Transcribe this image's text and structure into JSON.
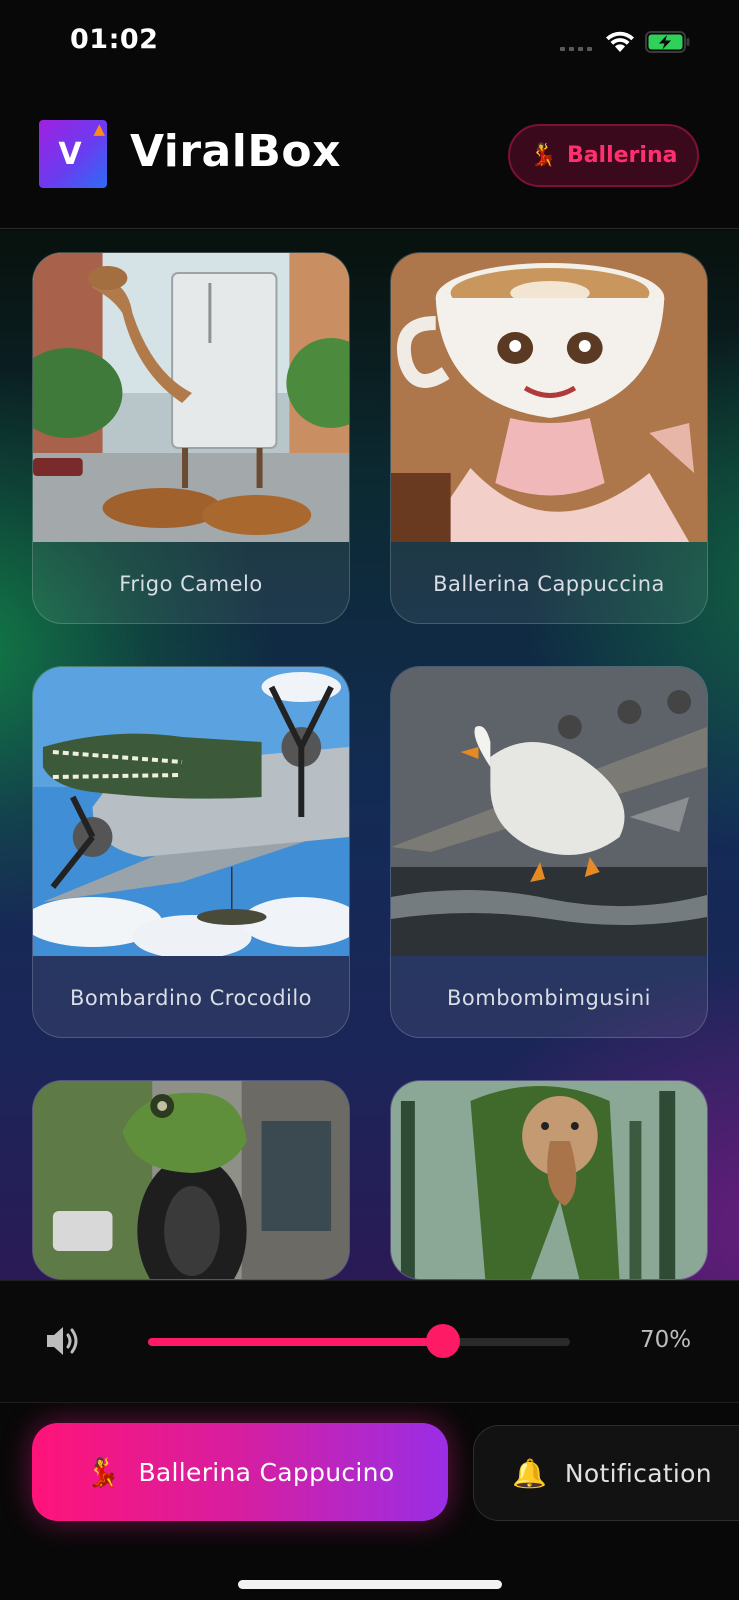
{
  "status_bar": {
    "time": "01:02"
  },
  "header": {
    "app_name": "ViralBox",
    "logo_letter": "V",
    "logo_icon": "flame-icon",
    "pill": {
      "emoji": "💃",
      "label": "Ballerina"
    }
  },
  "cards": [
    {
      "title": "Frigo Camelo",
      "image": "camel-fridge-image"
    },
    {
      "title": "Ballerina Cappuccina",
      "image": "ballerina-cappuccina-image"
    },
    {
      "title": "Bombardino Crocodilo",
      "image": "crocodile-bomber-image"
    },
    {
      "title": "Bombombimgusini",
      "image": "goose-plane-image"
    },
    {
      "title": "",
      "image": "frog-tire-image"
    },
    {
      "title": "",
      "image": "tree-monkey-image"
    }
  ],
  "volume": {
    "icon": "speaker-icon",
    "level": 0.7,
    "label": "70%"
  },
  "bottom_buttons": {
    "primary": {
      "emoji": "💃",
      "label": "Ballerina Cappucino"
    },
    "secondary": {
      "emoji": "🔔",
      "label": "Notification"
    }
  },
  "colors": {
    "accent": "#ff1a66",
    "gradient_start": "#ff1479",
    "gradient_end": "#9a2ee6"
  }
}
